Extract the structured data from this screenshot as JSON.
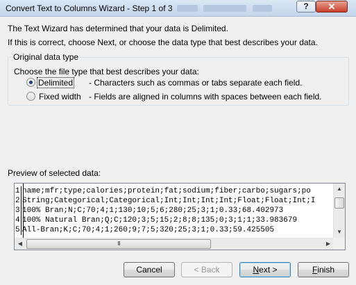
{
  "window": {
    "title": "Convert Text to Columns Wizard - Step 1 of 3",
    "help_label": "?",
    "close_label": "✕"
  },
  "intro": {
    "line1": "The Text Wizard has determined that your data is Delimited.",
    "line2": "If this is correct, choose Next, or choose the data type that best describes your data."
  },
  "data_type": {
    "legend": "Original data type",
    "prompt": "Choose the file type that best describes your data:",
    "options": [
      {
        "label": "Delimited",
        "selected": true,
        "description": "- Characters such as commas or tabs separate each field."
      },
      {
        "label": "Fixed width",
        "selected": false,
        "description": "- Fields are aligned in columns with spaces between each field."
      }
    ]
  },
  "preview": {
    "label": "Preview of selected data:",
    "rows": [
      {
        "num": "1",
        "text": "name;mfr;type;calories;protein;fat;sodium;fiber;carbo;sugars;po"
      },
      {
        "num": "2",
        "text": "String;Categorical;Categorical;Int;Int;Int;Int;Float;Float;Int;I"
      },
      {
        "num": "3",
        "text": "100% Bran;N;C;70;4;1;130;10;5;6;280;25;3;1;0.33;68.402973"
      },
      {
        "num": "4",
        "text": "100% Natural Bran;Q;C;120;3;5;15;2;8;8;135;0;3;1;1;33.983679"
      },
      {
        "num": "5",
        "text": "All-Bran;K;C;70;4;1;260;9;7;5;320;25;3;1;0.33;59.425505"
      }
    ],
    "hscroll_thumb_grip": "III"
  },
  "buttons": {
    "cancel": "Cancel",
    "back": "< Back",
    "next_u": "N",
    "next_rest": "ext >",
    "finish_u": "F",
    "finish_rest": "inish"
  }
}
